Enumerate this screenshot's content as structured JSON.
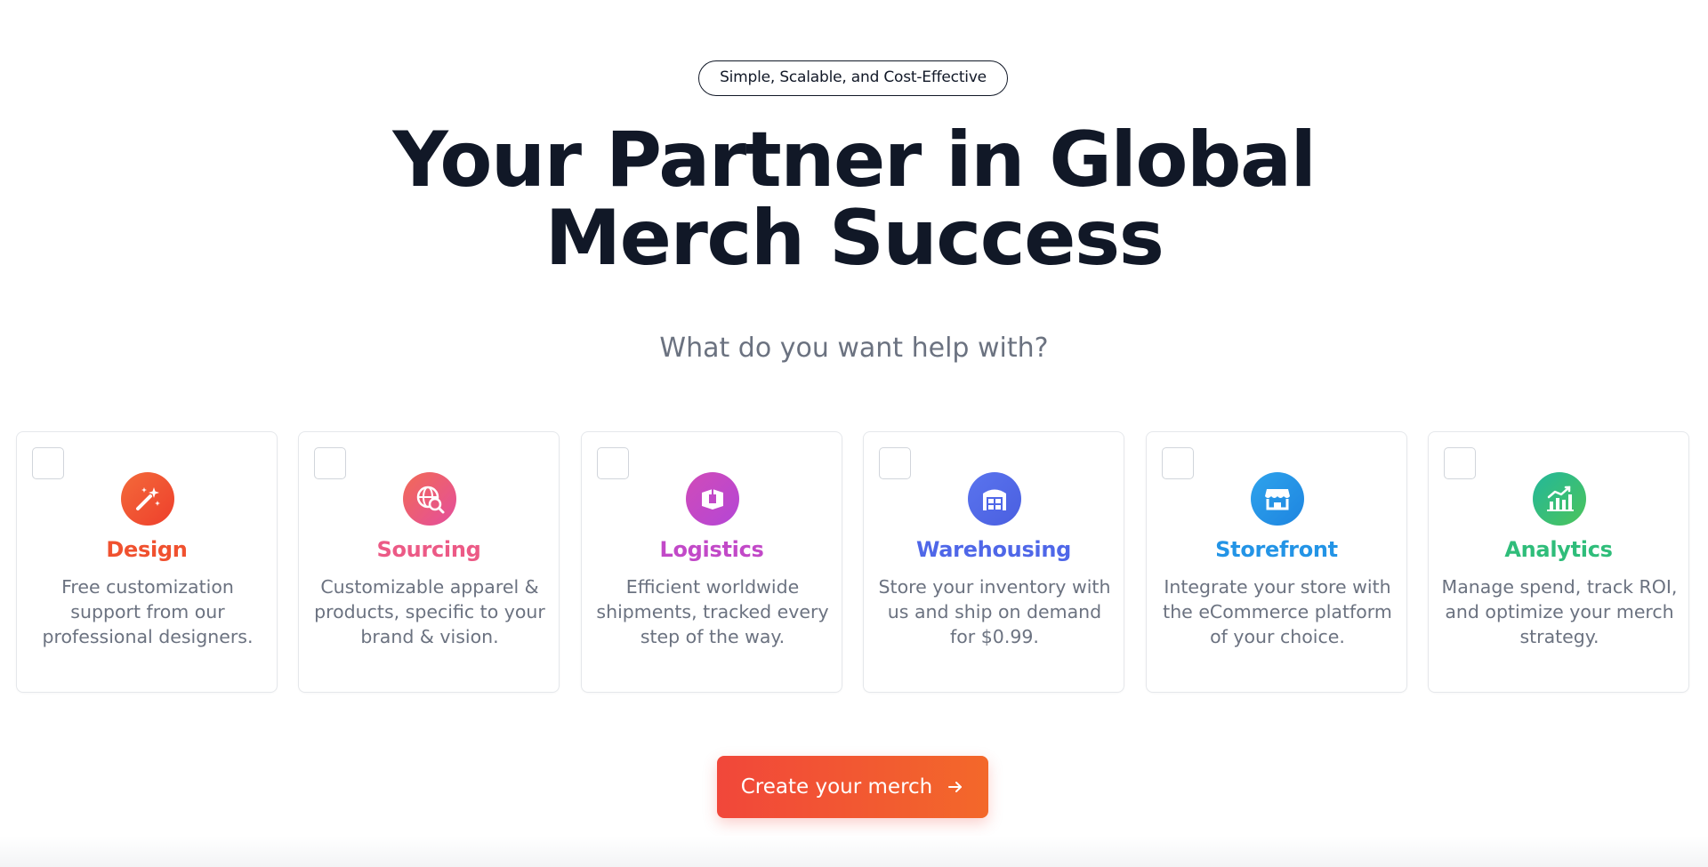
{
  "hero": {
    "eyebrow": "Simple, Scalable, and Cost-Effective",
    "headline_line1": "Your Partner in Global",
    "headline_line2": "Merch Success",
    "question": "What do you want help with?"
  },
  "cards": [
    {
      "title": "Design",
      "description": "Free customization support from our professional designers.",
      "icon": "magic-wand-icon",
      "color": "#f0512f",
      "checked": false
    },
    {
      "title": "Sourcing",
      "description": "Customizable apparel & products, specific to your brand & vision.",
      "icon": "globe-search-icon",
      "color": "#ec5a86",
      "checked": false
    },
    {
      "title": "Logistics",
      "description": "Efficient worldwide shipments, tracked every step of the way.",
      "icon": "package-icon",
      "color": "#c249c8",
      "checked": false
    },
    {
      "title": "Warehousing",
      "description": "Store your inventory with us and ship on demand for $0.99.",
      "icon": "warehouse-icon",
      "color": "#4f67e8",
      "checked": false
    },
    {
      "title": "Storefront",
      "description": "Integrate your store with the eCommerce platform of your choice.",
      "icon": "storefront-icon",
      "color": "#2394e6",
      "checked": false
    },
    {
      "title": "Analytics",
      "description": "Manage spend, track ROI, and optimize your merch strategy.",
      "icon": "analytics-chart-icon",
      "color": "#2fbd7a",
      "checked": false
    }
  ],
  "cta": {
    "label": "Create your merch",
    "icon": "arrow-right-icon"
  }
}
